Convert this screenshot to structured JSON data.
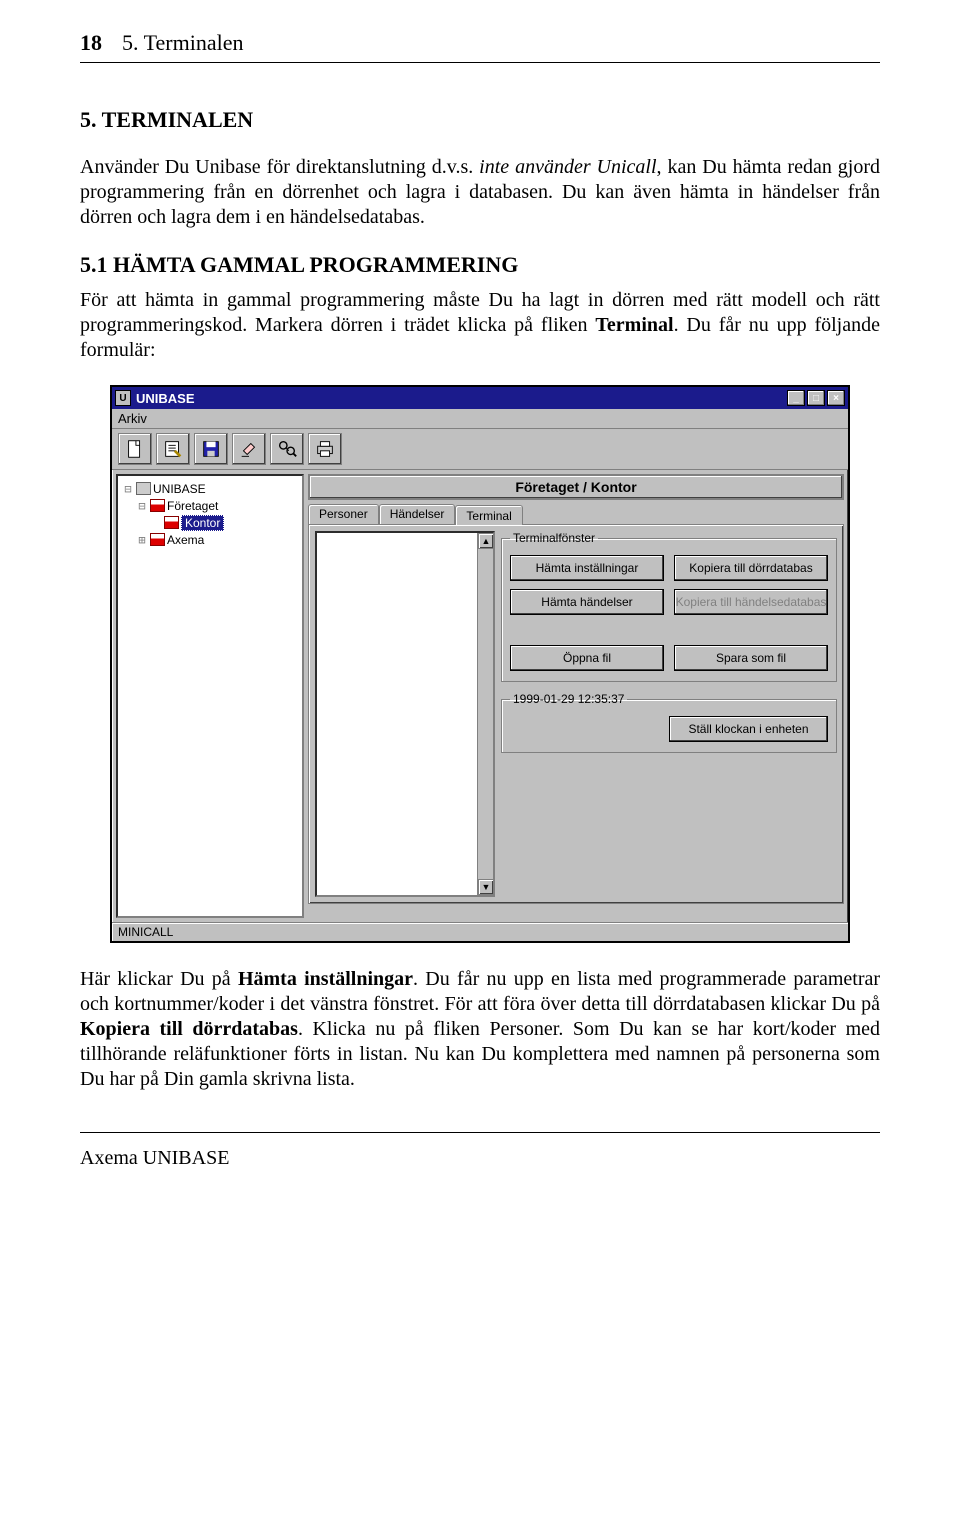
{
  "header": {
    "page_number": "18",
    "section": "5. Terminalen"
  },
  "heading": "5. TERMINALEN",
  "para1_pre": "Använder Du Unibase för direktanslutning d.v.s. ",
  "para1_em": "inte använder Unicall",
  "para1_post": ", kan Du hämta redan gjord programmering från en dörrenhet och lagra i databasen. Du kan även hämta in händelser från dörren och lagra dem i en händelsedatabas.",
  "subheading": "5.1 HÄMTA GAMMAL PROGRAMMERING",
  "para2_pre": "För att hämta in gammal programmering måste Du ha lagt in dörren med rätt modell och rätt programmeringskod. Markera dörren i trädet klicka på fliken ",
  "para2_b": "Terminal",
  "para2_post": ". Du får nu upp följande formulär:",
  "window": {
    "title": "UNIBASE",
    "menu": {
      "file": "Arkiv"
    },
    "panel_title": "Företaget / Kontor",
    "tabs": {
      "personer": "Personer",
      "handelser": "Händelser",
      "terminal": "Terminal"
    },
    "tree": {
      "root": "UNIBASE",
      "n1": "Företaget",
      "n1a": "Kontor",
      "n2": "Axema"
    },
    "group_terminal": "Terminalfönster",
    "buttons": {
      "hamta_installningar": "Hämta inställningar",
      "kopiera_dorr": "Kopiera till dörrdatabas",
      "hamta_handelser": "Hämta händelser",
      "kopiera_handelse": "Kopiera till händelsedatabas",
      "oppna_fil": "Öppna fil",
      "spara_som": "Spara som fil",
      "stall_klockan": "Ställ klockan i enheten"
    },
    "clock_legend": "1999-01-29   12:35:37",
    "status": "MINICALL"
  },
  "para3": {
    "t1": "Här klickar Du på ",
    "b1": "Hämta inställningar",
    "t2": ". Du får nu upp en lista med programmerade parametrar och kortnummer/koder i det vänstra fönstret. För att föra över detta till dörrdatabasen klickar Du på ",
    "b2": "Kopiera till dörrdatabas",
    "t3": ". Klicka nu på fliken Personer. Som Du kan se har kort/koder med tillhörande reläfunktioner förts in listan. Nu kan Du komplettera med namnen på personerna som Du har på Din gamla skrivna lista."
  },
  "footer": "Axema UNIBASE"
}
